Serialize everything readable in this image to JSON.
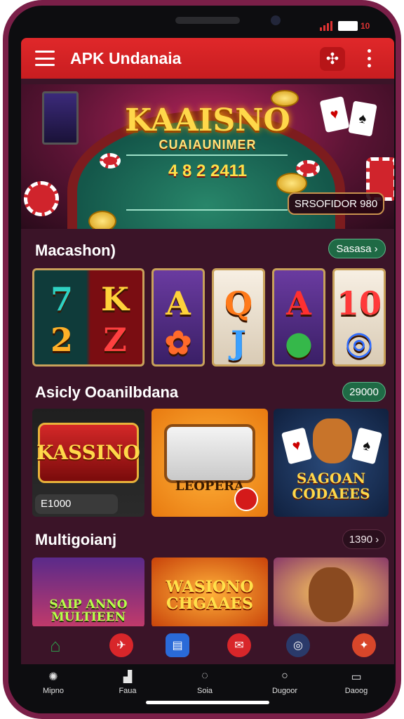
{
  "app_bar": {
    "title": "APK Undanaia",
    "action_icon": "puzzle-icon",
    "menu_icon": "hamburger-icon",
    "more_icon": "more-vertical-icon"
  },
  "status_bar": {
    "battery_label": "10"
  },
  "banner": {
    "title": "KAAISNO",
    "subtitle": "CUAIAUNIMER",
    "numbers": "4 8 2 2411",
    "pill_label": "SRSOFIDOR 980"
  },
  "sections": {
    "machines": {
      "title": "Macashon)",
      "button_label": "Sasasa"
    },
    "featured": {
      "title": "Asicly Ooanilbdana",
      "button_label": "29000"
    },
    "multi": {
      "title": "Multigoianj",
      "button_label": "1390 ›"
    }
  },
  "reels": [
    {
      "top": "7",
      "bottom": "2",
      "color_top": "#2fd1c2",
      "color_bottom": "#ffb028"
    },
    {
      "top": "K",
      "bottom": "Z",
      "color_top": "#ffd23a",
      "color_bottom": "#ff4040"
    },
    {
      "top": "A",
      "bottom": "✿",
      "color_top": "#ffd23a",
      "color_bottom": "#ff6a2a"
    },
    {
      "top": "Q",
      "bottom": "J",
      "color_top": "#ff7a1a",
      "color_bottom": "#3aa0ff"
    },
    {
      "top": "A",
      "bottom": "●",
      "color_top": "#ff3030",
      "color_bottom": "#35b84a"
    },
    {
      "top": "10",
      "bottom": "◎",
      "color_top": "#ff3a3a",
      "color_bottom": "#2f6cff"
    }
  ],
  "featured_cards": [
    {
      "label": "KASSINO",
      "sub": "E1000"
    },
    {
      "label": "LEOPERA",
      "sub": ""
    },
    {
      "label": "SAGOAN CODAEES",
      "sub": ""
    }
  ],
  "multi_cards": [
    {
      "label": "SAIP ANNO MULTIEEN"
    },
    {
      "label": "WASIONO CHGAAES"
    },
    {
      "label": ""
    }
  ],
  "nav_icons": [
    "home-icon",
    "rocket-icon",
    "list-icon",
    "gift-icon",
    "target-icon",
    "jackpot-icon"
  ],
  "tabs": [
    {
      "label": "Mipno",
      "icon": "controller-icon"
    },
    {
      "label": "Faua",
      "icon": "slot-icon"
    },
    {
      "label": "Soia",
      "icon": "chat-icon"
    },
    {
      "label": "Dugoor",
      "icon": "circle-icon"
    },
    {
      "label": "Daoog",
      "icon": "ticket-icon"
    }
  ],
  "colors": {
    "app_bar": "#d82225",
    "content_bg": "#3b1428",
    "phone_frame": "#7a1f48",
    "accent_gold": "#ffd84a",
    "green": "#1f6a45"
  }
}
